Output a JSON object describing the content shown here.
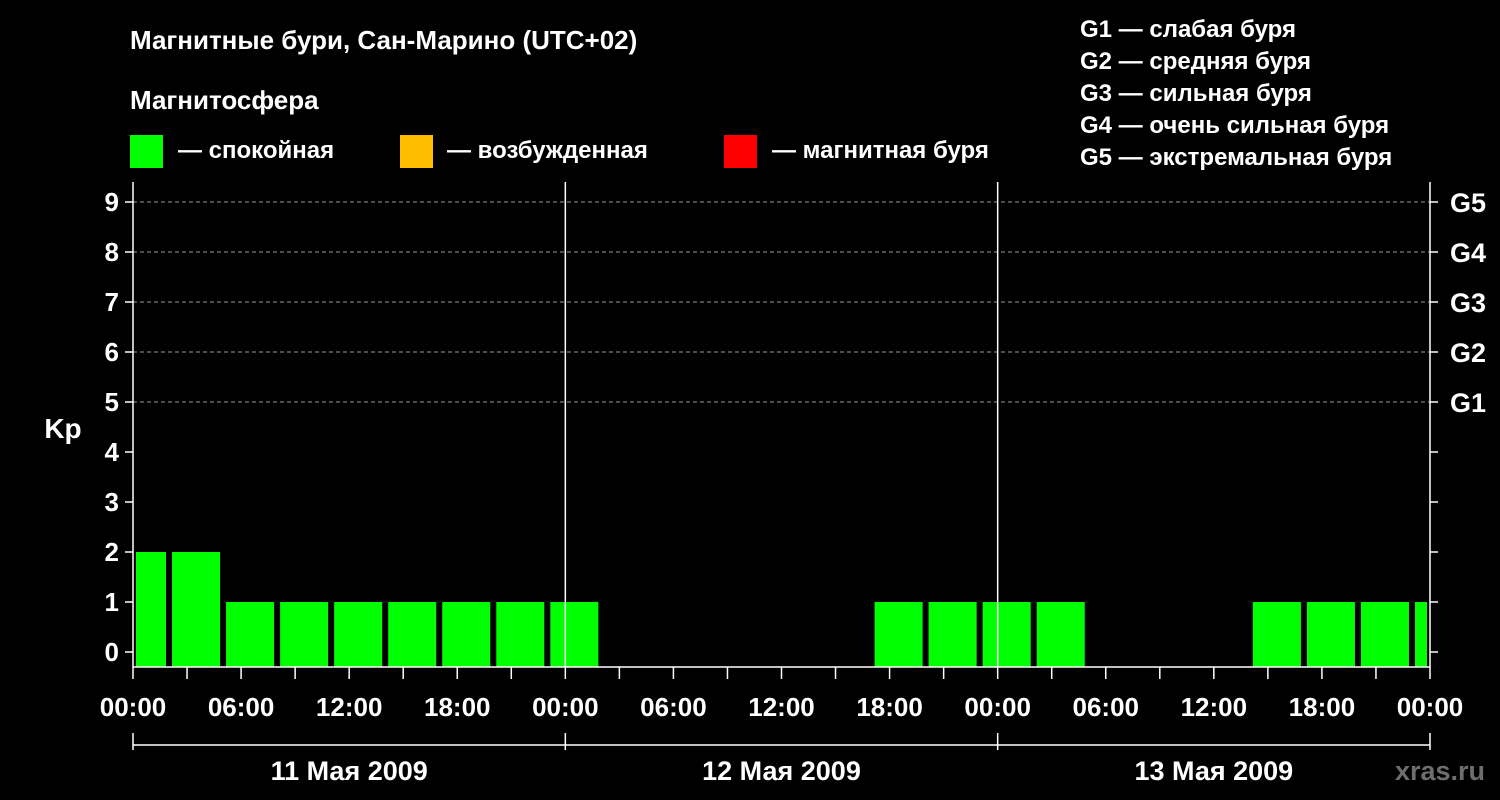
{
  "header": {
    "title": "Магнитные бури, Сан-Марино (UTC+02)",
    "subtitle": "Магнитосфера"
  },
  "state_legend": [
    {
      "label": "— спокойная",
      "color": "#00ff00"
    },
    {
      "label": "— возбужденная",
      "color": "#ffbf00"
    },
    {
      "label": "— магнитная буря",
      "color": "#ff0000"
    }
  ],
  "g_legend": [
    "G1 — слабая буря",
    "G2 — средняя буря",
    "G3 — сильная буря",
    "G4 — очень сильная буря",
    "G5 — экстремальная буря"
  ],
  "watermark": "xras.ru",
  "chart_data": {
    "type": "bar",
    "ylabel": "Kp",
    "ylim": [
      0,
      9
    ],
    "yticks": [
      "0",
      "1",
      "2",
      "3",
      "4",
      "5",
      "6",
      "7",
      "8",
      "9"
    ],
    "g_axis": [
      {
        "kp": 5,
        "label": "G1"
      },
      {
        "kp": 6,
        "label": "G2"
      },
      {
        "kp": 7,
        "label": "G3"
      },
      {
        "kp": 8,
        "label": "G4"
      },
      {
        "kp": 9,
        "label": "G5"
      }
    ],
    "xlim_hours": [
      0,
      72
    ],
    "x_unit": "hours from 11 Мая 2009 00:00 (UTC+02)",
    "xticks": [
      {
        "h": 0,
        "label": "00:00"
      },
      {
        "h": 6,
        "label": "06:00"
      },
      {
        "h": 12,
        "label": "12:00"
      },
      {
        "h": 18,
        "label": "18:00"
      },
      {
        "h": 24,
        "label": "00:00"
      },
      {
        "h": 30,
        "label": "06:00"
      },
      {
        "h": 36,
        "label": "12:00"
      },
      {
        "h": 42,
        "label": "18:00"
      },
      {
        "h": 48,
        "label": "00:00"
      },
      {
        "h": 54,
        "label": "06:00"
      },
      {
        "h": 60,
        "label": "12:00"
      },
      {
        "h": 66,
        "label": "18:00"
      },
      {
        "h": 72,
        "label": "00:00"
      }
    ],
    "days": [
      {
        "label": "11 Мая 2009",
        "start_h": 0,
        "end_h": 24
      },
      {
        "label": "12 Мая 2009",
        "start_h": 24,
        "end_h": 48
      },
      {
        "label": "13 Мая 2009",
        "start_h": 48,
        "end_h": 72
      }
    ],
    "grid": "horizontal dashed at Kp 5–9",
    "bar_color": "#00ff00",
    "bars": [
      {
        "start_h": 0,
        "end_h": 2,
        "kp": 2
      },
      {
        "start_h": 2,
        "end_h": 5,
        "kp": 2
      },
      {
        "start_h": 5,
        "end_h": 8,
        "kp": 1
      },
      {
        "start_h": 8,
        "end_h": 11,
        "kp": 1
      },
      {
        "start_h": 11,
        "end_h": 14,
        "kp": 1
      },
      {
        "start_h": 14,
        "end_h": 17,
        "kp": 1
      },
      {
        "start_h": 17,
        "end_h": 20,
        "kp": 1
      },
      {
        "start_h": 20,
        "end_h": 23,
        "kp": 1
      },
      {
        "start_h": 23,
        "end_h": 26,
        "kp": 1
      },
      {
        "start_h": 41,
        "end_h": 44,
        "kp": 1
      },
      {
        "start_h": 44,
        "end_h": 47,
        "kp": 1
      },
      {
        "start_h": 47,
        "end_h": 50,
        "kp": 1
      },
      {
        "start_h": 50,
        "end_h": 53,
        "kp": 1
      },
      {
        "start_h": 62,
        "end_h": 65,
        "kp": 1
      },
      {
        "start_h": 65,
        "end_h": 68,
        "kp": 1
      },
      {
        "start_h": 68,
        "end_h": 71,
        "kp": 1
      },
      {
        "start_h": 71,
        "end_h": 72,
        "kp": 1
      }
    ]
  }
}
